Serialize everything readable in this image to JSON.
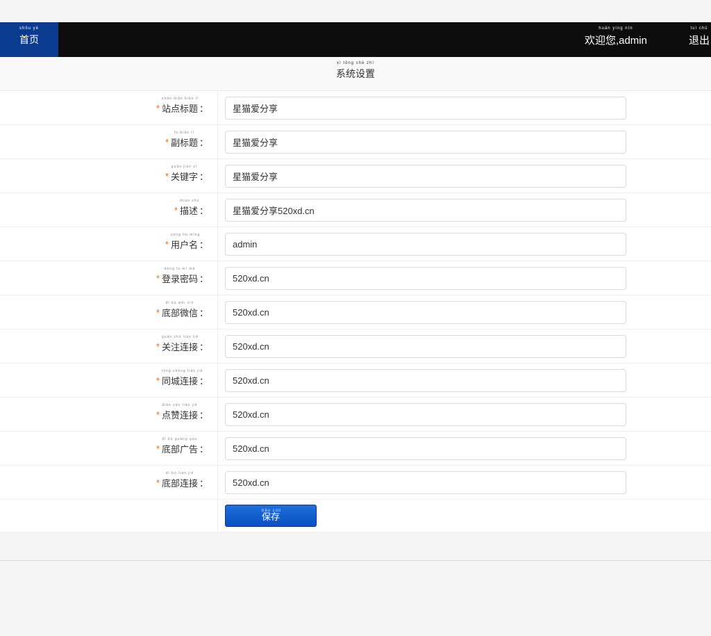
{
  "header": {
    "home": "首页",
    "home_pinyin": "shǒu yè",
    "welcome": "欢迎您,admin",
    "welcome_pinyin": "huān yíng nín",
    "logout": "退出",
    "logout_pinyin": "tuì chū"
  },
  "page": {
    "title": "系统设置",
    "title_pinyin": "xì tǒng shè zhì"
  },
  "form": {
    "fields": [
      {
        "id": "site-title",
        "label": "站点标题",
        "pinyin": "zhàn diǎn biāo tí",
        "value": "星猫爱分享"
      },
      {
        "id": "subtitle",
        "label": "副标题",
        "pinyin": "fù biāo tí",
        "value": "星猫爱分享"
      },
      {
        "id": "keywords",
        "label": "关键字",
        "pinyin": "guān jiàn zì",
        "value": "星猫爱分享"
      },
      {
        "id": "description",
        "label": "描述",
        "pinyin": "miáo shù",
        "value": "星猫爱分享520xd.cn"
      },
      {
        "id": "username",
        "label": "用户名",
        "pinyin": "yòng hù míng",
        "value": "admin"
      },
      {
        "id": "password",
        "label": "登录密码",
        "pinyin": "dēng lù mì mǎ",
        "value": "520xd.cn"
      },
      {
        "id": "footer-wechat",
        "label": "底部微信",
        "pinyin": "dǐ bù wēi xìn",
        "value": "520xd.cn"
      },
      {
        "id": "follow-link",
        "label": "关注连接",
        "pinyin": "guān zhù lián jiē",
        "value": "520xd.cn"
      },
      {
        "id": "local-link",
        "label": "同城连接",
        "pinyin": "tóng chéng lián jiē",
        "value": "520xd.cn"
      },
      {
        "id": "like-link",
        "label": "点赞连接",
        "pinyin": "diǎn zàn lián jiē",
        "value": "520xd.cn"
      },
      {
        "id": "footer-ad",
        "label": "底部广告",
        "pinyin": "dǐ bù guǎng gào",
        "value": "520xd.cn"
      },
      {
        "id": "footer-link",
        "label": "底部连接",
        "pinyin": "dǐ bù lián jiē",
        "value": "520xd.cn"
      }
    ],
    "save_label": "保存",
    "save_pinyin": "bǎo cún"
  }
}
